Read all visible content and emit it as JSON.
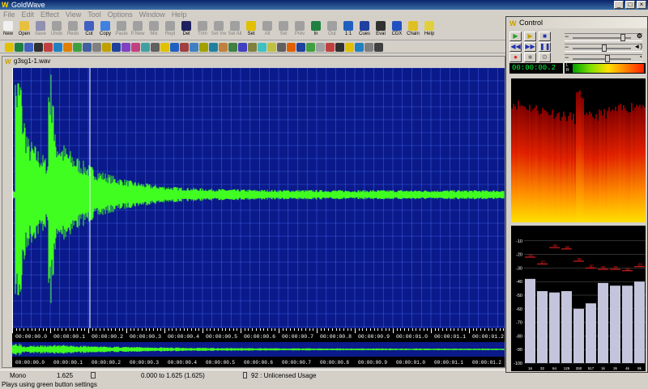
{
  "window": {
    "title": "GoldWave",
    "logo": "W"
  },
  "window_buttons": [
    "_",
    "□",
    "×"
  ],
  "menu": [
    "File",
    "Edit",
    "Effect",
    "View",
    "Tool",
    "Options",
    "Window",
    "Help"
  ],
  "toolbar": [
    {
      "label": "New",
      "enabled": true,
      "color": "#f0f0f0"
    },
    {
      "label": "Open",
      "enabled": true,
      "color": "#e8c040"
    },
    {
      "label": "Save",
      "enabled": false,
      "color": "#9090b0"
    },
    {
      "label": "Undo",
      "enabled": false,
      "color": "#a0a0a0"
    },
    {
      "label": "Redo",
      "enabled": false,
      "color": "#a0a0a0"
    },
    {
      "label": "Cut",
      "enabled": true,
      "color": "#4060c0"
    },
    {
      "label": "Copy",
      "enabled": true,
      "color": "#4080e0"
    },
    {
      "label": "Paste",
      "enabled": false,
      "color": "#a0a0a0"
    },
    {
      "label": "P.New",
      "enabled": false,
      "color": "#a0a0a0"
    },
    {
      "label": "Mix",
      "enabled": false,
      "color": "#a0a0a0"
    },
    {
      "label": "Repl",
      "enabled": false,
      "color": "#a0a0a0"
    },
    {
      "label": "Del",
      "enabled": true,
      "color": "#202060"
    },
    {
      "label": "Trim",
      "enabled": false,
      "color": "#a0a0a0"
    },
    {
      "label": "Sel Vw",
      "enabled": false,
      "color": "#a0a0a0"
    },
    {
      "label": "Sel All",
      "enabled": false,
      "color": "#a0a0a0"
    },
    {
      "label": "Set",
      "enabled": true,
      "color": "#e0c000"
    },
    {
      "label": "All",
      "enabled": false,
      "color": "#a0a0a0"
    },
    {
      "label": "Sel",
      "enabled": false,
      "color": "#a0a0a0"
    },
    {
      "label": "Prev",
      "enabled": false,
      "color": "#a0a0a0"
    },
    {
      "label": "In",
      "enabled": true,
      "color": "#208040"
    },
    {
      "label": "Out",
      "enabled": false,
      "color": "#a0a0a0"
    },
    {
      "label": "1:1",
      "enabled": true,
      "color": "#2060c0"
    },
    {
      "label": "Cues",
      "enabled": true,
      "color": "#2040a0"
    },
    {
      "label": "Eval",
      "enabled": true,
      "color": "#303030"
    },
    {
      "label": "CDX",
      "enabled": true,
      "color": "#2050c0"
    },
    {
      "label": "Chain",
      "enabled": true,
      "color": "#e0c020"
    },
    {
      "label": "Help",
      "enabled": true,
      "color": "#e0d040"
    }
  ],
  "effects_toolbar_colors": [
    "#e0c000",
    "#208040",
    "#4060c0",
    "#303030",
    "#c04040",
    "#2080c0",
    "#e08000",
    "#40a040",
    "#4060a0",
    "#808080",
    "#c0a000",
    "#2040a0",
    "#8040c0",
    "#c04080",
    "#40a0a0",
    "#606060",
    "#e0c000",
    "#2060c0",
    "#a04040",
    "#4080c0",
    "#a0a000",
    "#2080a0",
    "#c08040",
    "#408040",
    "#4040c0",
    "#808040",
    "#40c0c0",
    "#c0c040",
    "#606060",
    "#e06000",
    "#2040a0",
    "#40a040",
    "#a0a0a0",
    "#c04040",
    "#303030",
    "#e0c000",
    "#2080c0",
    "#808080",
    "#404040"
  ],
  "document": {
    "title": "g3sg1-1.wav",
    "logo": "W",
    "time_labels": [
      "00:00:00.0",
      "00:00:00.1",
      "00:00:00.2",
      "00:00:00.3",
      "00:00:00.4",
      "00:00:00.5",
      "00:00:00.6",
      "00:00:00.7",
      "00:00:00.8",
      "00:00:00.9",
      "00:00:01.0",
      "00:00:01.1",
      "00:00:01.2"
    ],
    "duration_seconds": 1.625
  },
  "status": {
    "channel": "Mono",
    "length": "1.625",
    "selection": "0.000 to 1.625 (1.625)",
    "license": "92 : Unlicensed Usage"
  },
  "hint": "Plays using green button settings",
  "control": {
    "title": "Control",
    "logo": "W",
    "timer": "00:00:00.2",
    "channel_labels": [
      "L",
      "R"
    ],
    "transport_row1": [
      "▶",
      "▶",
      "■"
    ],
    "transport_row2": [
      "◀◀",
      "▶▶",
      "❚❚"
    ],
    "transport_row3": [
      "●",
      "■",
      "⊙"
    ],
    "slider_minus": "−",
    "volume_level": 0.9,
    "balance_level": 0.55,
    "speed_level": 0.6,
    "db_labels": [
      "-10",
      "-20",
      "-30",
      "-40",
      "-50",
      "-60",
      "-70",
      "-80",
      "-90",
      "-100"
    ],
    "band_labels": [
      "16",
      "32",
      "64",
      "125",
      "250",
      "517",
      "1k",
      "2k",
      "4k",
      "8k"
    ],
    "band_values_db": [
      -38,
      -47,
      -48,
      -47,
      -60,
      -56,
      -41,
      -43,
      -43,
      -40
    ],
    "band_peaks_db": [
      -22,
      -27,
      -15,
      -16,
      -25,
      -30,
      -31,
      -31,
      -32,
      -29
    ],
    "peak_labels": [
      "-22",
      "-27",
      "-15",
      "-16",
      "-25",
      "-30",
      "-31",
      "-31",
      "-32",
      "-29"
    ],
    "colors": {
      "waveform": "#40ff20",
      "background": "#0a1a8a",
      "grid": "#5070ff"
    }
  }
}
